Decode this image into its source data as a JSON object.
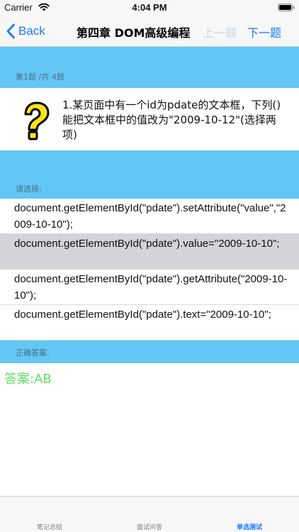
{
  "status_bar": {
    "carrier": "Carrier",
    "time": "4:04 PM",
    "icons": [
      "wifi-icon",
      "battery-icon"
    ]
  },
  "nav": {
    "back_label": "Back",
    "title": "第四章 DOM高级编程",
    "prev_label": "上一题",
    "next_label": "下一题"
  },
  "question": {
    "progress": "第1题 /共 4题",
    "icon": "question-mark-icon",
    "text": "1.某页面中有一个id为pdate的文本框，下列()能把文本框中的值改为\"2009-10-12\"(选择两项)"
  },
  "options": {
    "header": "请选择:",
    "items": [
      {
        "text": "document.getElementById(\"pdate\").setAttribute(\"value\",\"2009-10-10\");",
        "selected": false
      },
      {
        "text": "document.getElementById(\"pdate\").value=\"2009-10-10\";",
        "selected": true
      },
      {
        "text": "document.getElementById(\"pdate\").getAttribute(\"2009-10-10\");",
        "selected": false
      },
      {
        "text": "document.getElementById(\"pdate\").text=\"2009-10-10\";",
        "selected": false
      }
    ]
  },
  "answer": {
    "header": "正确答案:",
    "text": "答案:AB"
  },
  "tabs": [
    {
      "label": "笔记总结",
      "active": false
    },
    {
      "label": "面试问答",
      "active": false
    },
    {
      "label": "单选测试",
      "active": true
    }
  ],
  "colors": {
    "accent": "#1a7cf5",
    "section_header": "#62c7f5",
    "selected_row": "#d3d3d8",
    "answer": "#5fe062"
  }
}
